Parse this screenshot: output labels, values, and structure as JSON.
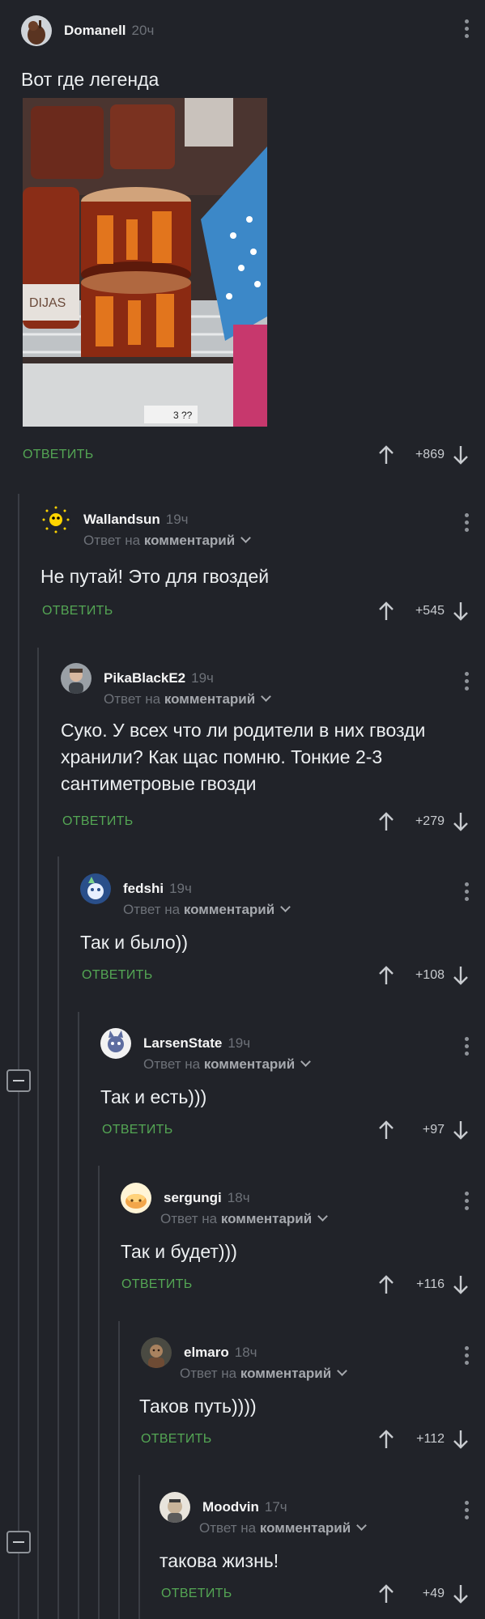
{
  "post": {
    "username": "Domanell",
    "time": "20ч",
    "text": "Вот где легенда",
    "image_description": "",
    "price_tag": "3 ??",
    "reply_label": "ОТВЕТИТЬ",
    "score": "+869"
  },
  "reply_to_label": "Ответ на",
  "reply_to_target": "комментарий",
  "reply_label": "ОТВЕТИТЬ",
  "comments": [
    {
      "username": "Wallandsun",
      "time": "19ч",
      "text": "Не путай! Это для гвоздей",
      "score": "+545"
    },
    {
      "username": "PikaBlackE2",
      "time": "19ч",
      "text": "Суко. У всех что ли родители в них гвозди хранили? Как щас помню. Тонкие 2-3 сантиметровые гвозди",
      "score": "+279"
    },
    {
      "username": "fedshi",
      "time": "19ч",
      "text": "Так и было))",
      "score": "+108"
    },
    {
      "username": "LarsenState",
      "time": "19ч",
      "text": "Так и есть)))",
      "score": "+97"
    },
    {
      "username": "sergungi",
      "time": "18ч",
      "text": "Так и будет)))",
      "score": "+116"
    },
    {
      "username": "elmaro",
      "time": "18ч",
      "text": "Таков путь))))",
      "score": "+112"
    },
    {
      "username": "Moodvin",
      "time": "17ч",
      "text": "такова жизнь!",
      "score": "+49"
    }
  ],
  "colors": {
    "background": "#212329",
    "accent_green": "#54a654",
    "muted": "#6d7178"
  }
}
